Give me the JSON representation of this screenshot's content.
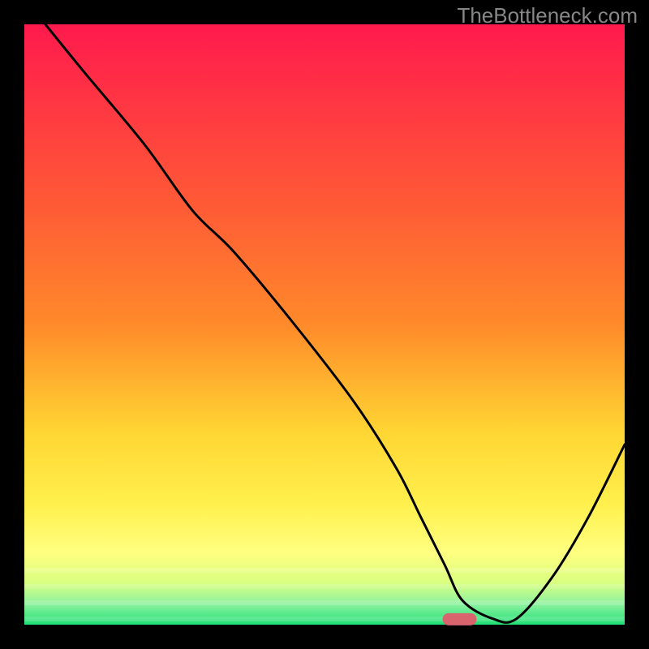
{
  "watermark": "TheBottleneck.com",
  "chart_data": {
    "type": "line",
    "title": "",
    "xlabel": "",
    "ylabel": "",
    "xlim": [
      0,
      100
    ],
    "ylim": [
      0,
      100
    ],
    "background_gradient": {
      "top": "#ff1a4d",
      "upper_mid": "#ff8a2a",
      "mid": "#ffd633",
      "lower_mid": "#ffff80",
      "bottom": "#1fe074"
    },
    "series": [
      {
        "name": "curve",
        "x": [
          3.5,
          10,
          20,
          28,
          35,
          45,
          55,
          62,
          66,
          70,
          73,
          78,
          82,
          88,
          94,
          100
        ],
        "values": [
          100,
          92,
          80,
          69,
          62,
          50,
          37,
          26,
          18,
          10,
          4,
          1,
          1,
          8,
          18,
          30
        ]
      }
    ],
    "marker": {
      "name": "target-pill",
      "x": 72.5,
      "y": 0.9,
      "color": "#d9646e"
    },
    "frame": {
      "outer_size": 800,
      "plot_left": 30,
      "plot_top": 30,
      "plot_size": 740
    }
  }
}
